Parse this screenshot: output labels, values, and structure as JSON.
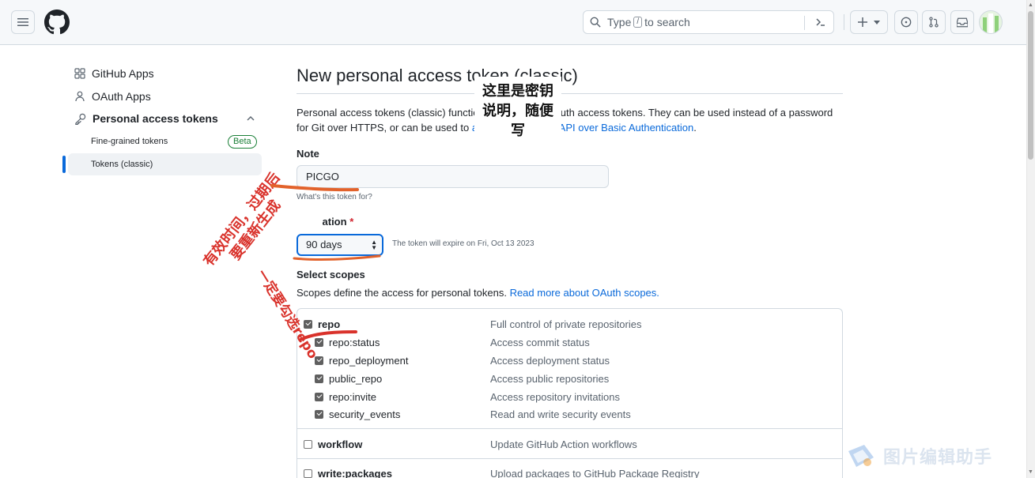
{
  "header": {
    "search_prefix": "Type",
    "search_key": "/",
    "search_suffix": "to search"
  },
  "sidebar": {
    "items": [
      {
        "label": "GitHub Apps",
        "icon": "apps-icon"
      },
      {
        "label": "OAuth Apps",
        "icon": "person-icon"
      },
      {
        "label": "Personal access tokens",
        "icon": "key-icon"
      }
    ],
    "sub_items": [
      {
        "label": "Fine-grained tokens",
        "badge": "Beta"
      },
      {
        "label": "Tokens (classic)"
      }
    ]
  },
  "main": {
    "title": "New personal access token (classic)",
    "description_part1": "Personal access tokens (classic) function like ordinary OAuth access tokens. They can be used instead of a password for Git over HTTPS, or can be used to ",
    "description_link": "authenticate to the API over Basic Authentication",
    "description_end": ".",
    "note_label": "Note",
    "note_value": "PICGO",
    "note_hint": "What's this token for?",
    "expiration_label": "Expiration",
    "expiration_required": "*",
    "expiration_value": "90 days",
    "expiration_note": "The token will expire on Fri, Oct 13 2023",
    "scopes_label": "Select scopes",
    "scopes_desc": "Scopes define the access for personal tokens.",
    "scopes_link": "Read more about OAuth scopes.",
    "scopes": [
      {
        "name": "repo",
        "desc": "Full control of private repositories",
        "checked": true
      },
      {
        "name": "repo:status",
        "desc": "Access commit status",
        "checked": true
      },
      {
        "name": "repo_deployment",
        "desc": "Access deployment status",
        "checked": true
      },
      {
        "name": "public_repo",
        "desc": "Access public repositories",
        "checked": true
      },
      {
        "name": "repo:invite",
        "desc": "Access repository invitations",
        "checked": true
      },
      {
        "name": "security_events",
        "desc": "Read and write security events",
        "checked": true
      },
      {
        "name": "workflow",
        "desc": "Update GitHub Action workflows",
        "checked": false
      },
      {
        "name": "write:packages",
        "desc": "Upload packages to GitHub Package Registry",
        "checked": false
      }
    ]
  },
  "annotations": {
    "callout": "这里是密钥说明，随便写",
    "validity": "有效时间，过期后要重新生成",
    "repo_note": "一定要勾选repo"
  },
  "watermark": "图片编辑助手",
  "colors": {
    "accent": "#0969da",
    "success": "#1a7f37",
    "annotation_red": "#d9322b"
  }
}
